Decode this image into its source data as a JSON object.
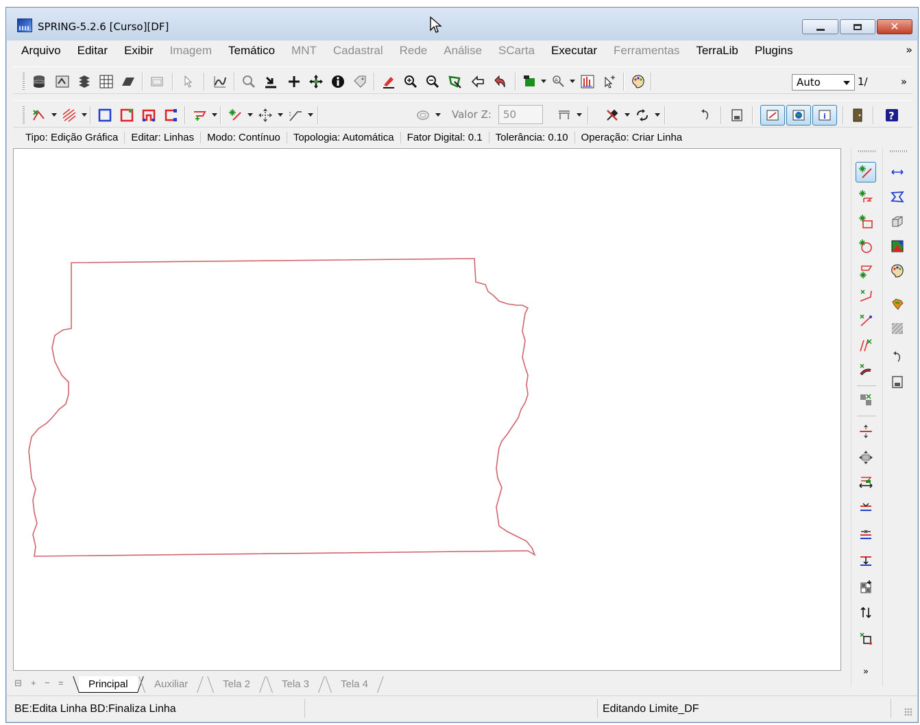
{
  "window": {
    "title": "SPRING-5.2.6 [Curso][DF]"
  },
  "menu": [
    {
      "label": "Arquivo",
      "enabled": true
    },
    {
      "label": "Editar",
      "enabled": true
    },
    {
      "label": "Exibir",
      "enabled": true
    },
    {
      "label": "Imagem",
      "enabled": false
    },
    {
      "label": "Temático",
      "enabled": true
    },
    {
      "label": "MNT",
      "enabled": false
    },
    {
      "label": "Cadastral",
      "enabled": false
    },
    {
      "label": "Rede",
      "enabled": false
    },
    {
      "label": "Análise",
      "enabled": false
    },
    {
      "label": "SCarta",
      "enabled": false
    },
    {
      "label": "Executar",
      "enabled": true
    },
    {
      "label": "Ferramentas",
      "enabled": false
    },
    {
      "label": "TerraLib",
      "enabled": true
    },
    {
      "label": "Plugins",
      "enabled": true
    }
  ],
  "menu_more": "»",
  "toolbar1": {
    "zoom_mode": "Auto",
    "scale_text": "1/",
    "more": "»"
  },
  "toolbar2": {
    "valor_z_label": "Valor Z:",
    "valor_z_value": "50"
  },
  "info": [
    "Tipo: Edição Gráfica",
    "Editar: Linhas",
    "Modo: Contínuo",
    "Topologia: Automática",
    "Fator Digital: 0.1",
    "Tolerância: 0.10",
    "Operação: Criar Linha"
  ],
  "tabs": [
    {
      "label": "Principal",
      "active": true
    },
    {
      "label": "Auxiliar",
      "active": false
    },
    {
      "label": "Tela 2",
      "active": false
    },
    {
      "label": "Tela 3",
      "active": false
    },
    {
      "label": "Tela 4",
      "active": false
    }
  ],
  "status": {
    "left": "BE:Edita Linha  BD:Finaliza Linha",
    "right": "Editando Limite_DF"
  },
  "colors": {
    "boundary_line": "#d0646e",
    "window_frame": "#6f8caa"
  }
}
